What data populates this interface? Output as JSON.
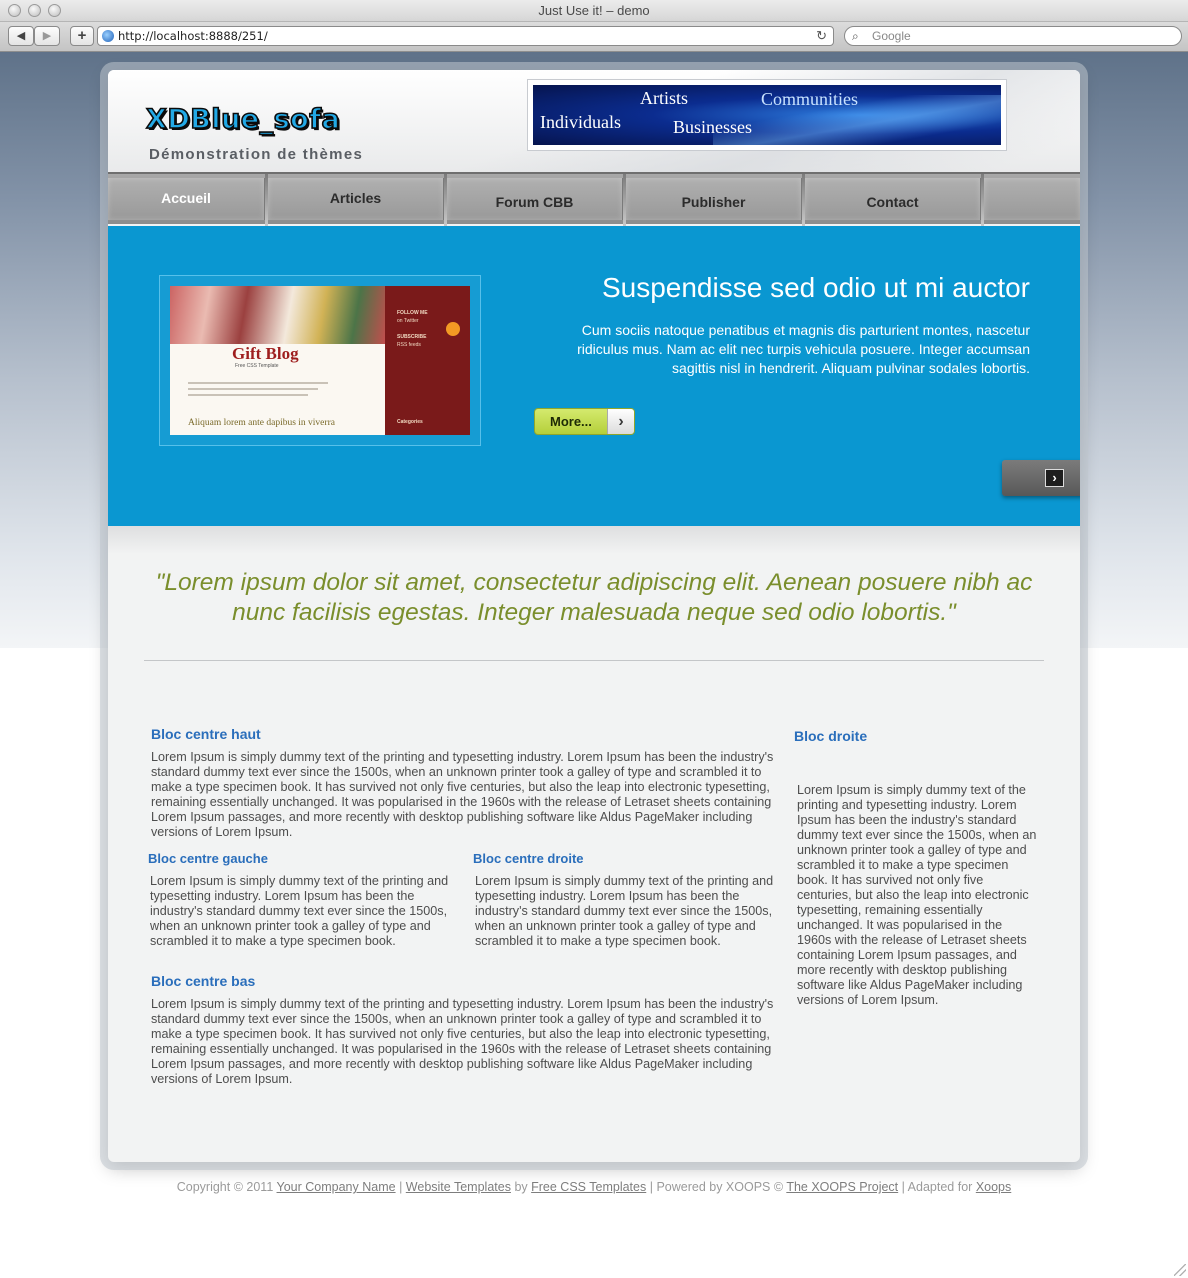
{
  "browser": {
    "window_title": "Just Use it! – demo",
    "url": "http://localhost:8888/251/",
    "search_placeholder": "Google",
    "back_icon": "◀",
    "forward_icon": "▶",
    "add_icon": "+",
    "reload_icon": "↻",
    "search_icon": "⌕"
  },
  "header": {
    "logo": "XDBlue_sofa",
    "slogan": "Démonstration de thèmes",
    "banner": {
      "word1": "Artists",
      "word2": "Communities",
      "word3": "Individuals",
      "word4": "Businesses"
    }
  },
  "menu": {
    "items": [
      {
        "label": "Accueil"
      },
      {
        "label": "Articles"
      },
      {
        "label": "Forum CBB"
      },
      {
        "label": "Publisher"
      },
      {
        "label": "Contact"
      }
    ]
  },
  "feature": {
    "title": "Suspendisse sed odio ut mi auctor",
    "text": "Cum sociis natoque penatibus et magnis dis parturient montes, nascetur ridiculus mus. Nam ac elit nec turpis vehicula posuere. Integer accumsan sagittis nisl in hendrerit. Aliquam pulvinar sodales lobortis.",
    "more_label": "More...",
    "more_arrow": "›",
    "next_arrow": "›",
    "thumbnail": {
      "title": "Gift Blog",
      "subtitle": "Free CSS Template",
      "follow": "FOLLOW ME",
      "twitter": "on Twitter",
      "subscribe": "SUBSCRIBE",
      "rss": "RSS feeds",
      "post_title": "Aliquam lorem ante dapibus in viverra",
      "categories": "Categories"
    }
  },
  "quote": "\"Lorem ipsum dolor sit amet, consectetur adipiscing elit. Aenean posuere nibh ac nunc facilisis egestas. Integer malesuada neque sed odio lobortis.\"",
  "blocks": {
    "centre_haut": {
      "title": "Bloc centre haut",
      "text": "Lorem Ipsum is simply dummy text of the printing and typesetting industry. Lorem Ipsum has been the industry's standard dummy text ever since the 1500s, when an unknown printer took a galley of type and scrambled it to make a type specimen book. It has survived not only five centuries, but also the leap into electronic typesetting, remaining essentially unchanged. It was popularised in the 1960s with the release of Letraset sheets containing Lorem Ipsum passages, and more recently with desktop publishing software like Aldus PageMaker including versions of Lorem Ipsum."
    },
    "centre_gauche": {
      "title": "Bloc centre gauche",
      "text": "Lorem Ipsum is simply dummy text of the printing and typesetting industry. Lorem Ipsum has been the industry's standard dummy text ever since the 1500s, when an unknown printer took a galley of type and scrambled it to make a type specimen book."
    },
    "centre_droite": {
      "title": "Bloc centre droite",
      "text": "Lorem Ipsum is simply dummy text of the printing and typesetting industry. Lorem Ipsum has been the industry's standard dummy text ever since the 1500s, when an unknown printer took a galley of type and scrambled it to make a type specimen book."
    },
    "centre_bas": {
      "title": "Bloc centre bas",
      "text": "Lorem Ipsum is simply dummy text of the printing and typesetting industry. Lorem Ipsum has been the industry's standard dummy text ever since the 1500s, when an unknown printer took a galley of type and scrambled it to make a type specimen book. It has survived not only five centuries, but also the leap into electronic typesetting, remaining essentially unchanged. It was popularised in the 1960s with the release of Letraset sheets containing Lorem Ipsum passages, and more recently with desktop publishing software like Aldus PageMaker including versions of Lorem Ipsum."
    },
    "droite": {
      "title": "Bloc droite",
      "text": "Lorem Ipsum is simply dummy text of the printing and typesetting industry. Lorem Ipsum has been the industry's standard dummy text ever since the 1500s, when an unknown printer took a galley of type and scrambled it to make a type specimen book. It has survived not only five centuries, but also the leap into electronic typesetting, remaining essentially unchanged. It was popularised in the 1960s with the release of Letraset sheets containing Lorem Ipsum passages, and more recently with desktop publishing software like Aldus PageMaker including versions of Lorem Ipsum."
    }
  },
  "footer": {
    "copyright": "Copyright © 2011",
    "company_link": "Your Company Name",
    "sep1": "|",
    "templates_link": "Website Templates",
    "by": "by",
    "free_css_link": "Free CSS Templates",
    "powered": "| Powered by XOOPS ©",
    "xoops_project_link": "The XOOPS Project",
    "adapted": "| Adapted for",
    "xoops_link": "Xoops"
  },
  "colors": {
    "accent_blue": "#0a97d1",
    "heading_blue": "#2a6ebb",
    "quote_green": "#7a8e2c",
    "button_green": "#c4dc52"
  }
}
